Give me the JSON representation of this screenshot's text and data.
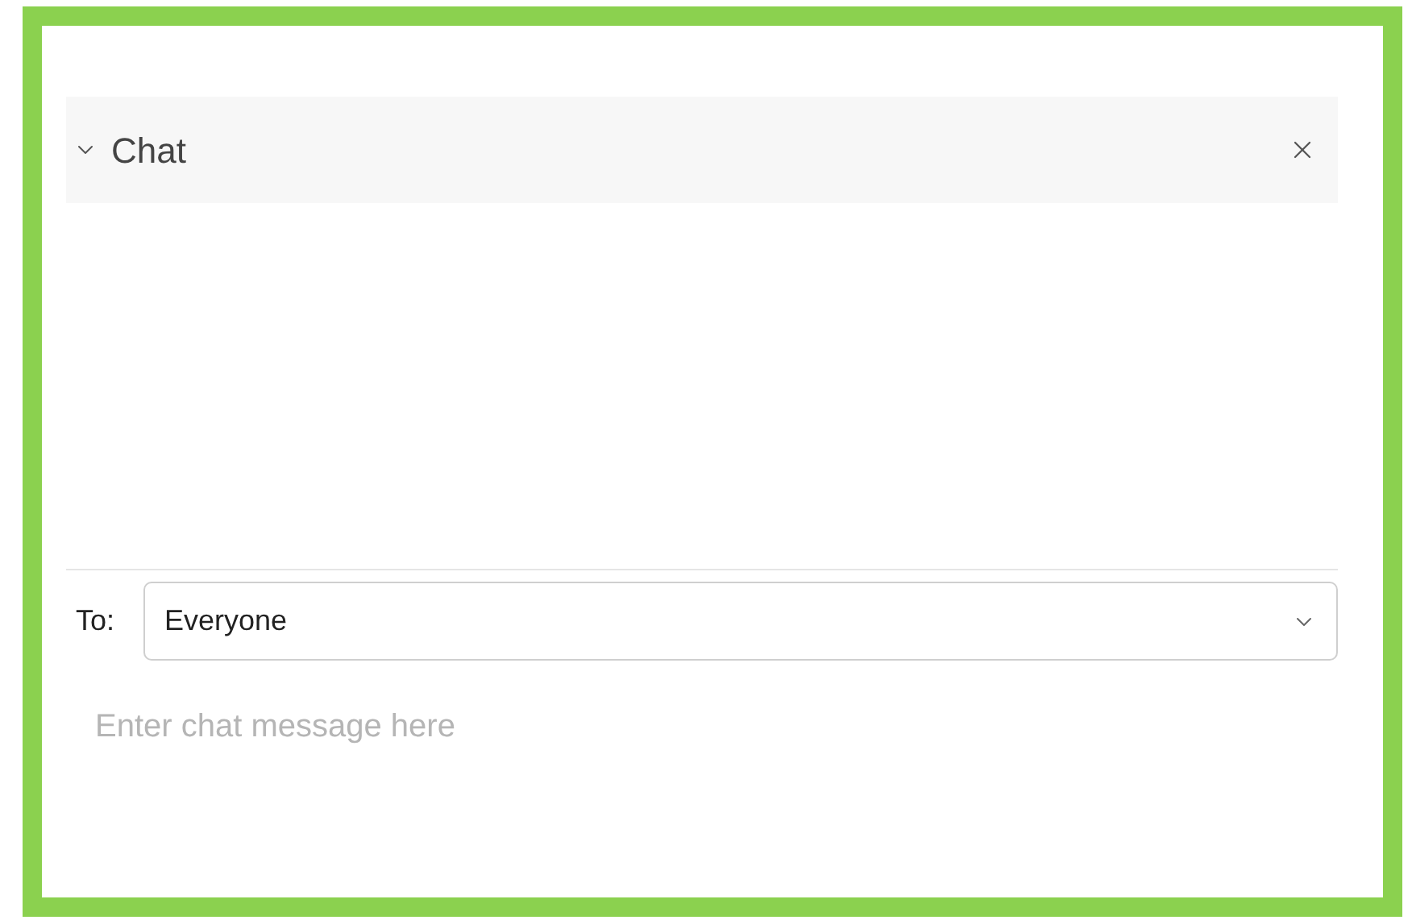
{
  "panel": {
    "title": "Chat",
    "expanded": true
  },
  "recipient": {
    "label": "To:",
    "value": "Everyone"
  },
  "message": {
    "placeholder": "Enter chat message here"
  }
}
